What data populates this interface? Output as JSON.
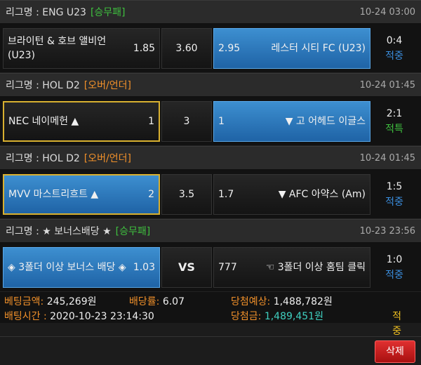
{
  "league_prefix": "리그명 : ",
  "matches": [
    {
      "league": "ENG U23",
      "tag": "[승무패]",
      "time": "10-24 03:00",
      "home": {
        "name": "브라이턴 & 호브 앨비언 (U23)",
        "odds": "1.85"
      },
      "mid": "3.60",
      "away": {
        "name": "레스터 시티 FC (U23)",
        "odds": "2.95"
      },
      "score": "0:4",
      "result": "적중"
    },
    {
      "league": "HOL D2",
      "tag": "[오버/언더]",
      "time": "10-24 01:45",
      "home": {
        "name": "NEC 네이메헌 ▲",
        "odds": "1"
      },
      "mid": "3",
      "away": {
        "name": "▼ 고 어헤드 이글스",
        "odds": "1"
      },
      "score": "2:1",
      "result": "적특"
    },
    {
      "league": "HOL D2",
      "tag": "[오버/언더]",
      "time": "10-24 01:45",
      "home": {
        "name": "MVV 마스트리흐트 ▲",
        "odds": "2"
      },
      "mid": "3.5",
      "away": {
        "name": "▼ AFC 아약스 (Am)",
        "odds": "1.7"
      },
      "score": "1:5",
      "result": "적중"
    },
    {
      "league": "★ 보너스배당 ★",
      "tag": "[승무패]",
      "time": "10-23 23:56",
      "home": {
        "name": "◈ 3폴더 이상 보너스 배당 ◈",
        "odds": "1.03"
      },
      "mid": "VS",
      "away": {
        "name": "☜ 3폴더 이상 홈팀 클릭",
        "odds": "777"
      },
      "score": "1:0",
      "result": "적중"
    }
  ],
  "summary": {
    "bet_amount_label": "베팅금액:",
    "bet_amount": "245,269원",
    "rate_label": "배당률:",
    "rate": "6.07",
    "expected_label": "당첨예상:",
    "expected": "1,488,782원",
    "bet_time_label": "배팅시간 :",
    "bet_time": "2020-10-23 23:14:30",
    "win_label": "당첨금:",
    "win": "1,489,451원",
    "status": "적중"
  },
  "delete_label": "삭제"
}
